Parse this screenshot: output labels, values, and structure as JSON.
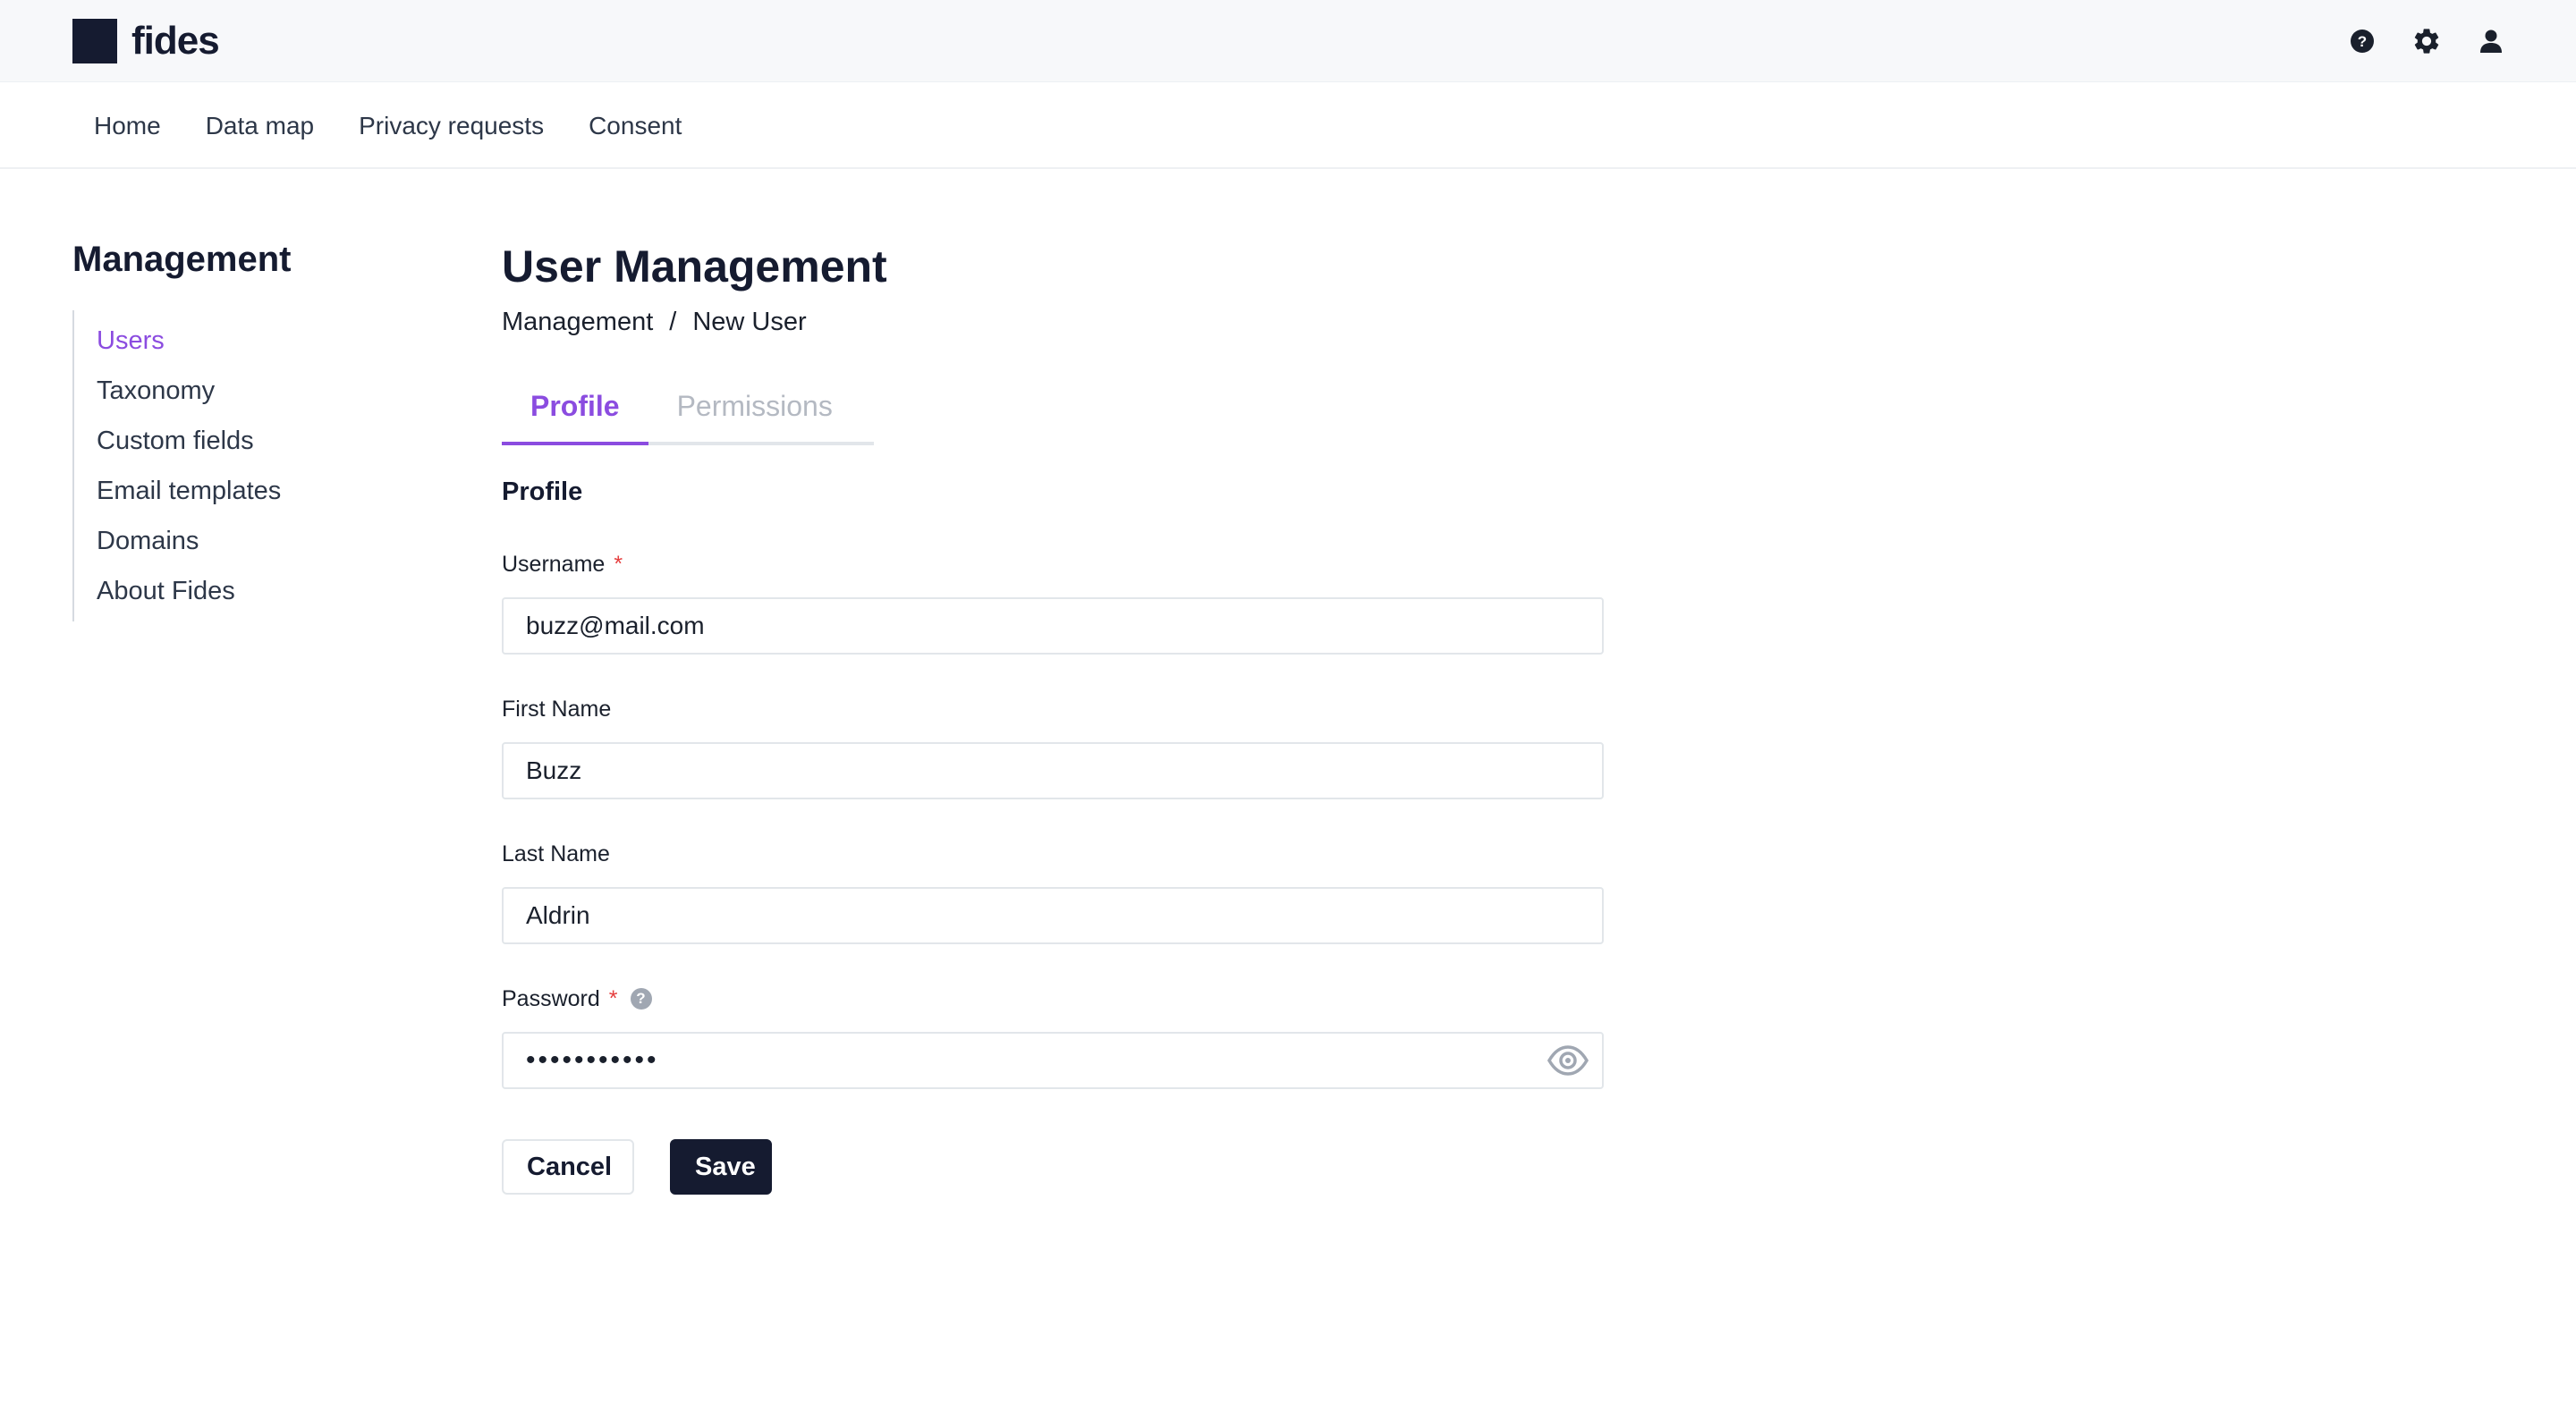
{
  "app": {
    "logo_text": "fides"
  },
  "header": {
    "icons": [
      "help-icon",
      "settings-icon",
      "user-icon"
    ]
  },
  "nav": {
    "items": [
      {
        "label": "Home"
      },
      {
        "label": "Data map"
      },
      {
        "label": "Privacy requests"
      },
      {
        "label": "Consent"
      }
    ]
  },
  "sidebar": {
    "title": "Management",
    "items": [
      {
        "label": "Users",
        "active": true
      },
      {
        "label": "Taxonomy"
      },
      {
        "label": "Custom fields"
      },
      {
        "label": "Email templates"
      },
      {
        "label": "Domains"
      },
      {
        "label": "About Fides"
      }
    ]
  },
  "main": {
    "title": "User Management",
    "breadcrumb": {
      "parent": "Management",
      "separator": "/",
      "current": "New User"
    },
    "tabs": [
      {
        "label": "Profile",
        "active": true
      },
      {
        "label": "Permissions",
        "active": false
      }
    ],
    "section_title": "Profile",
    "form": {
      "username": {
        "label": "Username",
        "required_mark": "*",
        "value": "buzz@mail.com"
      },
      "first_name": {
        "label": "First Name",
        "value": "Buzz"
      },
      "last_name": {
        "label": "Last Name",
        "value": "Aldrin"
      },
      "password": {
        "label": "Password",
        "required_mark": "*",
        "help_glyph": "?",
        "value": "•••••••••••"
      }
    },
    "actions": {
      "cancel_label": "Cancel",
      "save_label": "Save"
    }
  },
  "colors": {
    "accent": "#8b4ce0",
    "dark": "#151b30",
    "required": "#e53e3e"
  }
}
